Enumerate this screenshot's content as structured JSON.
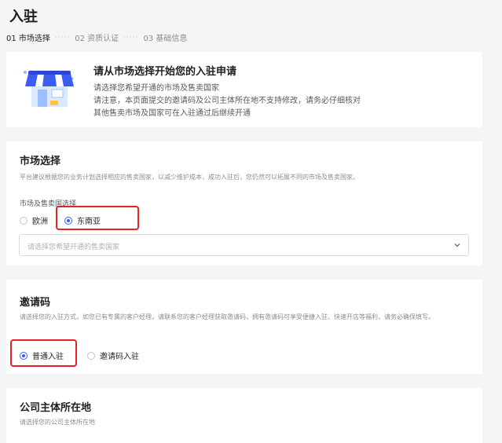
{
  "page": {
    "title": "入驻"
  },
  "steps": [
    {
      "label": "01 市场选择"
    },
    {
      "label": "02 资质认证"
    },
    {
      "label": "03 基础信息"
    }
  ],
  "intro": {
    "heading": "请从市场选择开始您的入驻申请",
    "lines": [
      "请选择您希望开通的市场及售卖国家",
      "请注意，本页面提交的邀请码及公司主体所在地不支持修改，请务必仔细核对",
      "其他售卖市场及国家可在入驻通过后继续开通"
    ]
  },
  "market": {
    "title": "市场选择",
    "description": "平台建议根据您的业务计划选择相应的售卖国家，以减少维护成本，成功入驻后，您仍然可以拓展不同的市场及售卖国家。",
    "label": "市场及售卖国选择",
    "options": [
      {
        "label": "欧洲",
        "selected": false
      },
      {
        "label": "东南亚",
        "selected": true
      }
    ],
    "select_placeholder": "请选择您希望开通的售卖国家"
  },
  "invite": {
    "title": "邀请码",
    "description": "请选择您的入驻方式，如您已有专属的客户经理，请联系您的客户经理获取邀请码，拥有邀请码可享受便捷入驻、快速开店等福利，请务必确保填写。",
    "options": [
      {
        "label": "普通入驻",
        "selected": true
      },
      {
        "label": "邀请码入驻",
        "selected": false
      }
    ]
  },
  "company": {
    "title": "公司主体所在地",
    "description": "请选择您的公司主体所在地"
  },
  "colors": {
    "accent": "#3d5cf5",
    "highlight": "#e32222"
  }
}
